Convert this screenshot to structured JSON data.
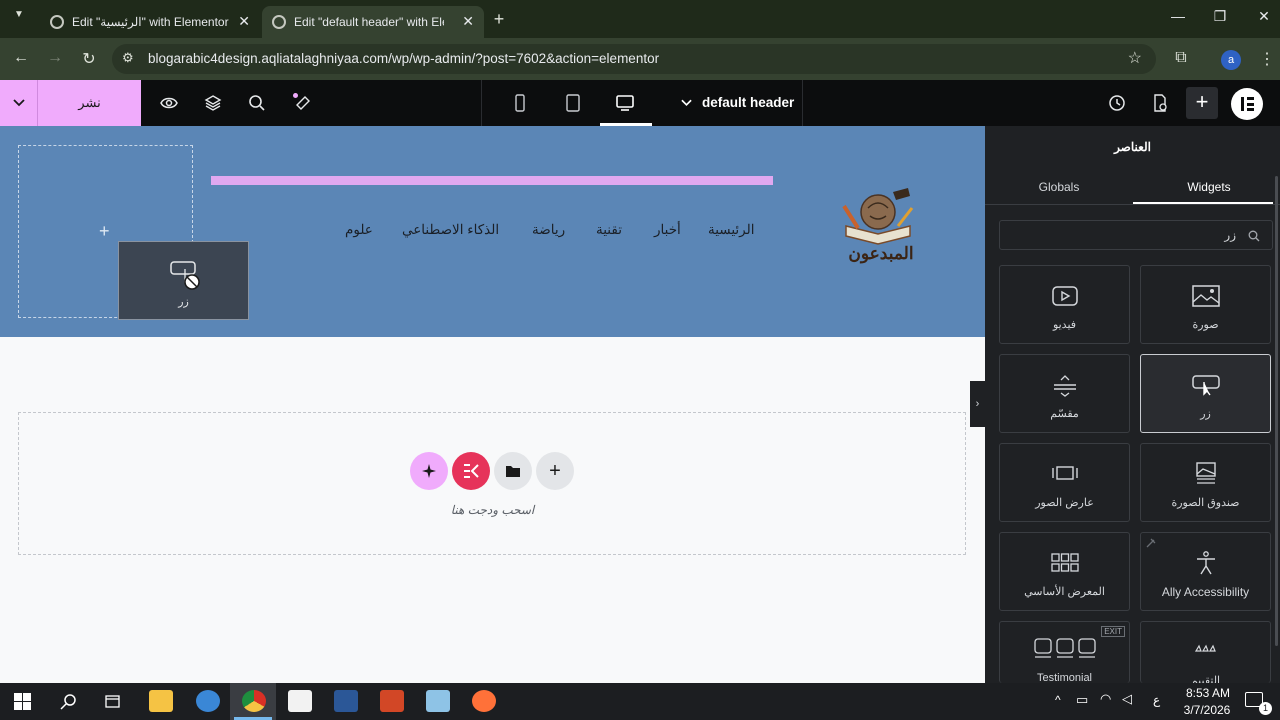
{
  "browser": {
    "tabs": [
      {
        "title": "Edit \"الرئيسية\" with Elementor"
      },
      {
        "title": "Edit \"default header\" with Elem"
      }
    ],
    "url": "blogarabic4design.aqliatalaghniyaa.com/wp/wp-admin/?post=7602&action=elementor",
    "profile_initial": "a"
  },
  "topbar": {
    "publish_label": "نشر",
    "document_title": "default header"
  },
  "canvas": {
    "nav_items": [
      "الرئيسية",
      "أخبار",
      "تقنية",
      "رياضة",
      "الذكاء الاصطناعي",
      "علوم"
    ],
    "logo_text": "المبدعون",
    "dragging_widget_label": "زر",
    "drop_hint": "اسحب ودجت هنا"
  },
  "panel": {
    "title": "العناصر",
    "tabs": {
      "globals": "Globals",
      "widgets": "Widgets"
    },
    "search_value": "زر",
    "widgets": [
      {
        "label": "صورة",
        "icon": "image-icon"
      },
      {
        "label": "فيديو",
        "icon": "video-icon"
      },
      {
        "label": "زر",
        "icon": "button-icon"
      },
      {
        "label": "مقسّم",
        "icon": "divider-icon"
      },
      {
        "label": "صندوق الصورة",
        "icon": "image-box-icon"
      },
      {
        "label": "عارض الصور",
        "icon": "image-carousel-icon"
      },
      {
        "label": "Ally Accessibility",
        "icon": "accessibility-icon"
      },
      {
        "label": "المعرض الأساسي",
        "icon": "basic-gallery-icon"
      },
      {
        "label": "التقييم",
        "icon": "star-rating-icon"
      },
      {
        "label": "Testimonial",
        "icon": "testimonial-carousel-icon",
        "badge": "EXIT"
      }
    ]
  },
  "taskbar": {
    "time": "8:53 AM",
    "date": "3/7/2026",
    "language": "ع",
    "notification_count": "1"
  },
  "colors": {
    "publish_bg": "#f0abfc",
    "header_bg": "#5b86b6",
    "panel_bg": "#1f2124",
    "accent_pink": "#e0a8f0",
    "elementor_red": "#e6335a"
  }
}
